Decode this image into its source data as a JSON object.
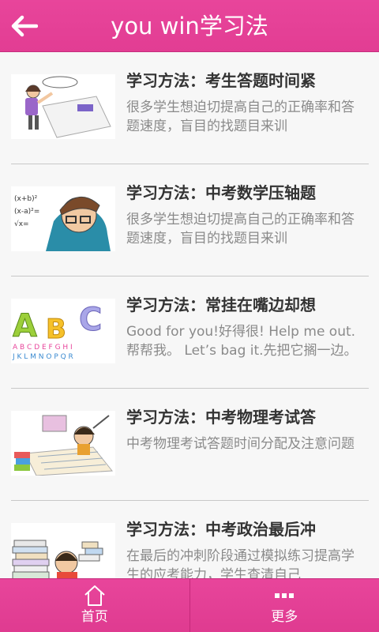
{
  "header": {
    "title": "you win学习法",
    "back_icon": "arrow-left-icon"
  },
  "articles": [
    {
      "title": "学习方法：考生答题时间紧",
      "summary": "很多学生想迫切提高自己的正确率和答题速度，盲目的找题目来训",
      "thumbnail": "student-exam-illustration"
    },
    {
      "title": "学习方法：中考数学压轴题",
      "summary": "很多学生想迫切提高自己的正确率和答题速度，盲目的找题目来训",
      "thumbnail": "stressed-student-math-illustration"
    },
    {
      "title": "学习方法：常挂在嘴边却想",
      "summary": "Good for you!好得很! Help me out.帮帮我。 Let’s bag it.先把它搁一边。",
      "thumbnail": "abc-alphabet-illustration"
    },
    {
      "title": "学习方法：中考物理考试答",
      "summary": "中考物理考试答题时间分配及注意问题",
      "thumbnail": "student-writing-illustration"
    },
    {
      "title": "学习方法：中考政治最后冲",
      "summary": "在最后的冲刺阶段通过模拟练习提高学生的应考能力，学生查清自己",
      "thumbnail": "book-pile-illustration"
    }
  ],
  "tabbar": {
    "tabs": [
      {
        "label": "首页",
        "icon": "home-icon"
      },
      {
        "label": "更多",
        "icon": "more-dots-icon"
      }
    ]
  },
  "colors": {
    "header": "#e8459b",
    "title_text": "#333333",
    "summary_text": "#8a8a8a",
    "background": "#f7f7f7"
  }
}
